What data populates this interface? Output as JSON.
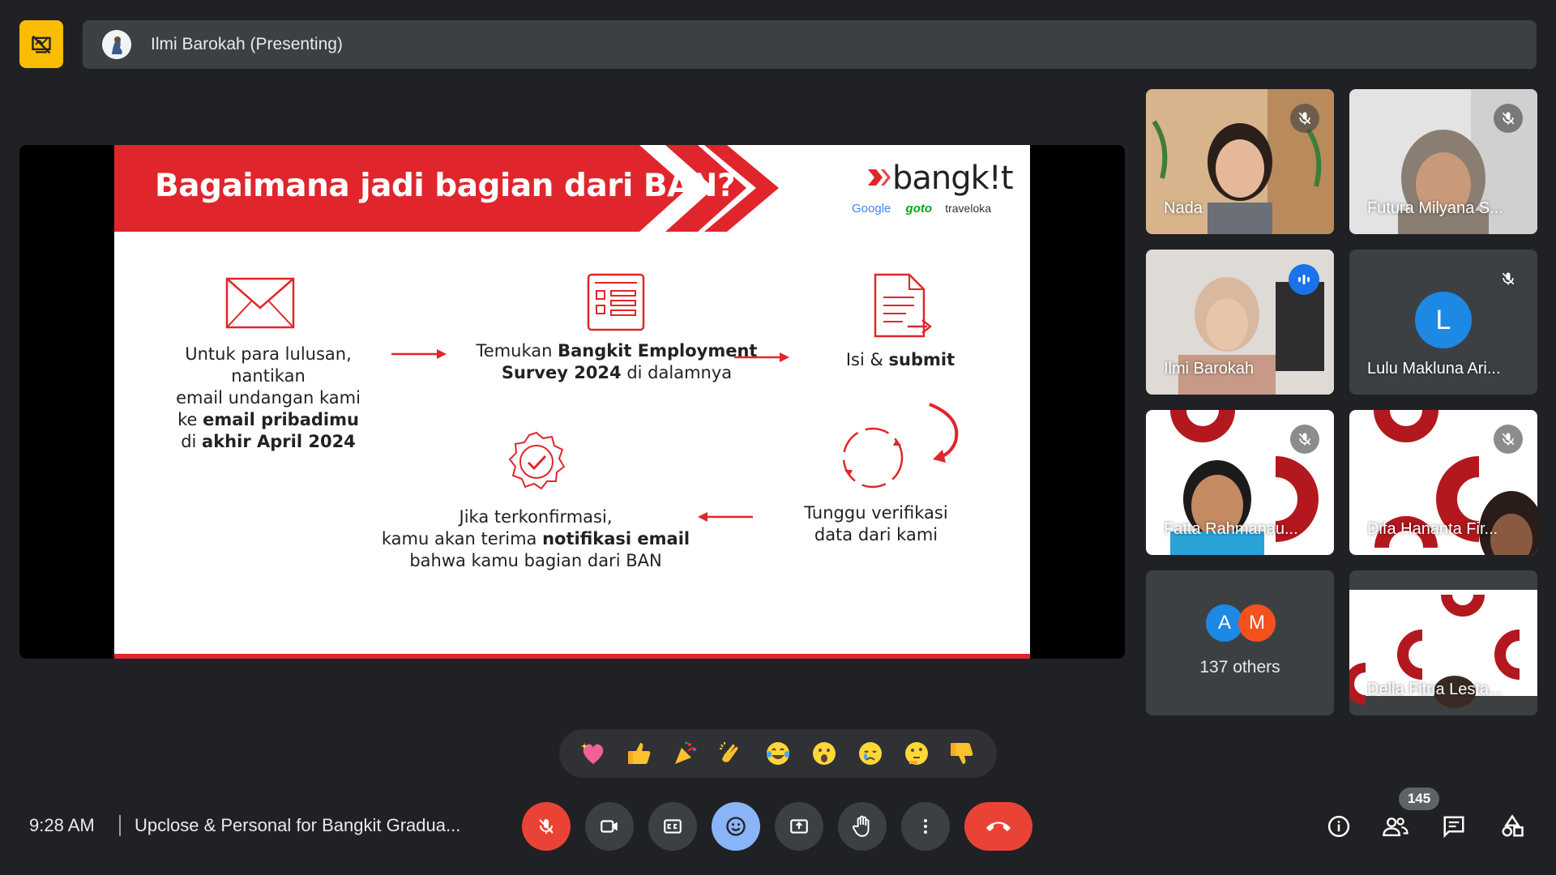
{
  "presenter_bar": {
    "name": "Ilmi Barokah (Presenting)"
  },
  "slide": {
    "title": "Bagaimana jadi bagian dari BAN?",
    "brand": {
      "name": "bangk!t",
      "partners": [
        "Google",
        "goto",
        "traveloka"
      ]
    },
    "steps": {
      "step1": [
        "Untuk para lulusan, nantikan",
        "email undangan kami",
        "ke ",
        "email pribadimu",
        "di ",
        "akhir April 2024"
      ],
      "step2": [
        "Temukan ",
        "Bangkit Employment",
        "Survey 2024",
        " di dalamnya"
      ],
      "step3": [
        "Isi & ",
        "submit"
      ],
      "step4": [
        "Tunggu verifikasi",
        "data dari kami"
      ],
      "step5": [
        "Jika terkonfirmasi,",
        "kamu akan terima ",
        "notifikasi email",
        "bahwa kamu bagian dari BAN"
      ]
    }
  },
  "participants": [
    {
      "name": "Nada",
      "muted": true
    },
    {
      "name": "Futura Milyana S...",
      "muted": true
    },
    {
      "name": "Ilmi Barokah",
      "speaking": true
    },
    {
      "name": "Lulu Makluna Ari...",
      "initial": "L",
      "muted": true
    },
    {
      "name": "Fatta Rahmanau...",
      "muted": true
    },
    {
      "name": "Difa Hananta Fir...",
      "muted": true
    },
    {
      "others_label": "137 others",
      "initials": [
        "A",
        "M"
      ]
    },
    {
      "name": "Della Fitria Lesta..."
    }
  ],
  "reactions": [
    "sparkling-heart",
    "thumbs-up",
    "party-popper",
    "clapping",
    "tears-of-joy",
    "surprised",
    "crying",
    "thinking",
    "thumbs-down"
  ],
  "bottom_bar": {
    "time": "9:28 AM",
    "meeting_title": "Upclose & Personal for Bangkit Gradua...",
    "participant_count": "145"
  },
  "colors": {
    "accent_red": "#e0262c",
    "meet_red": "#ea4335",
    "meet_blue": "#8ab4f8",
    "present_yellow": "#fbbc04"
  }
}
